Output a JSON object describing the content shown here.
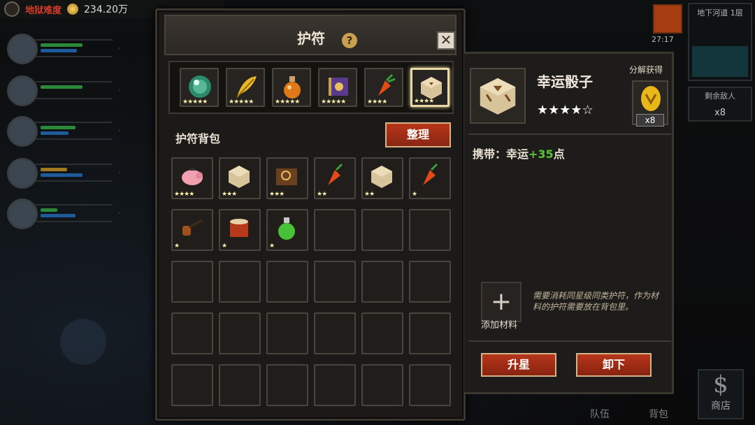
{
  "hud": {
    "difficulty": "地狱难度",
    "gold": "234.20万",
    "map_label": "地下河道 1层",
    "timer": "27:17",
    "enemy_label": "剩余敌人",
    "enemy_count": "x8",
    "shop_icon": "$",
    "shop_label": "商店",
    "team_label": "队伍",
    "bag_label": "背包"
  },
  "panel": {
    "title": "护符",
    "help": "?",
    "close": "✕",
    "equipped": [
      {
        "icon": "crystal-orb-icon",
        "stars": 5
      },
      {
        "icon": "golden-feather-icon",
        "stars": 5
      },
      {
        "icon": "potion-flask-icon",
        "stars": 5
      },
      {
        "icon": "spellbook-icon",
        "stars": 5
      },
      {
        "icon": "carrot-charm-icon",
        "stars": 4
      },
      {
        "icon": "lucky-dice-icon",
        "stars": 4,
        "selected": true
      }
    ],
    "bag_title": "护符背包",
    "sort_button": "整理",
    "bag_items": [
      {
        "icon": "piggy-bank-icon",
        "stars": 4
      },
      {
        "icon": "lucky-dice-icon",
        "stars": 3
      },
      {
        "icon": "magnifier-book-icon",
        "stars": 3
      },
      {
        "icon": "carrot-charm-icon",
        "stars": 2
      },
      {
        "icon": "lucky-dice-icon",
        "stars": 2
      },
      {
        "icon": "carrot-charm-icon",
        "stars": 1
      },
      {
        "icon": "smoking-pipe-icon",
        "stars": 1
      },
      {
        "icon": "drum-icon",
        "stars": 1
      },
      {
        "icon": "green-potion-icon",
        "stars": 1
      }
    ]
  },
  "detail": {
    "name": "幸运骰子",
    "stars_filled": 4,
    "stars_total": 5,
    "decompose_label": "分解获得",
    "decompose_count": "x8",
    "carry_prefix": "携带：幸运",
    "carry_value": "+35",
    "carry_suffix": "点",
    "add_material_label": "添加材料",
    "add_icon": "+",
    "note": "需要消耗同星级同类护符，作为材料的护符需要放在背包里。",
    "upgrade_button": "升星",
    "unequip_button": "卸下"
  },
  "colors": {
    "accent_red": "#a8301a",
    "highlight_green": "#58c638",
    "difficulty_red": "#d83a2a"
  }
}
